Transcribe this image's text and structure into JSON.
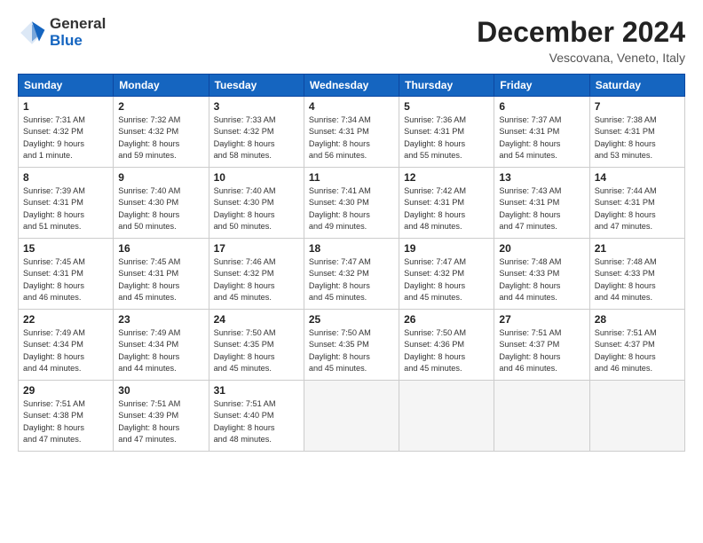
{
  "logo": {
    "general": "General",
    "blue": "Blue"
  },
  "title": {
    "month": "December 2024",
    "location": "Vescovana, Veneto, Italy"
  },
  "weekdays": [
    "Sunday",
    "Monday",
    "Tuesday",
    "Wednesday",
    "Thursday",
    "Friday",
    "Saturday"
  ],
  "weeks": [
    [
      {
        "day": "1",
        "lines": [
          "Sunrise: 7:31 AM",
          "Sunset: 4:32 PM",
          "Daylight: 9 hours",
          "and 1 minute."
        ]
      },
      {
        "day": "2",
        "lines": [
          "Sunrise: 7:32 AM",
          "Sunset: 4:32 PM",
          "Daylight: 8 hours",
          "and 59 minutes."
        ]
      },
      {
        "day": "3",
        "lines": [
          "Sunrise: 7:33 AM",
          "Sunset: 4:32 PM",
          "Daylight: 8 hours",
          "and 58 minutes."
        ]
      },
      {
        "day": "4",
        "lines": [
          "Sunrise: 7:34 AM",
          "Sunset: 4:31 PM",
          "Daylight: 8 hours",
          "and 56 minutes."
        ]
      },
      {
        "day": "5",
        "lines": [
          "Sunrise: 7:36 AM",
          "Sunset: 4:31 PM",
          "Daylight: 8 hours",
          "and 55 minutes."
        ]
      },
      {
        "day": "6",
        "lines": [
          "Sunrise: 7:37 AM",
          "Sunset: 4:31 PM",
          "Daylight: 8 hours",
          "and 54 minutes."
        ]
      },
      {
        "day": "7",
        "lines": [
          "Sunrise: 7:38 AM",
          "Sunset: 4:31 PM",
          "Daylight: 8 hours",
          "and 53 minutes."
        ]
      }
    ],
    [
      {
        "day": "8",
        "lines": [
          "Sunrise: 7:39 AM",
          "Sunset: 4:31 PM",
          "Daylight: 8 hours",
          "and 51 minutes."
        ]
      },
      {
        "day": "9",
        "lines": [
          "Sunrise: 7:40 AM",
          "Sunset: 4:30 PM",
          "Daylight: 8 hours",
          "and 50 minutes."
        ]
      },
      {
        "day": "10",
        "lines": [
          "Sunrise: 7:40 AM",
          "Sunset: 4:30 PM",
          "Daylight: 8 hours",
          "and 50 minutes."
        ]
      },
      {
        "day": "11",
        "lines": [
          "Sunrise: 7:41 AM",
          "Sunset: 4:30 PM",
          "Daylight: 8 hours",
          "and 49 minutes."
        ]
      },
      {
        "day": "12",
        "lines": [
          "Sunrise: 7:42 AM",
          "Sunset: 4:31 PM",
          "Daylight: 8 hours",
          "and 48 minutes."
        ]
      },
      {
        "day": "13",
        "lines": [
          "Sunrise: 7:43 AM",
          "Sunset: 4:31 PM",
          "Daylight: 8 hours",
          "and 47 minutes."
        ]
      },
      {
        "day": "14",
        "lines": [
          "Sunrise: 7:44 AM",
          "Sunset: 4:31 PM",
          "Daylight: 8 hours",
          "and 47 minutes."
        ]
      }
    ],
    [
      {
        "day": "15",
        "lines": [
          "Sunrise: 7:45 AM",
          "Sunset: 4:31 PM",
          "Daylight: 8 hours",
          "and 46 minutes."
        ]
      },
      {
        "day": "16",
        "lines": [
          "Sunrise: 7:45 AM",
          "Sunset: 4:31 PM",
          "Daylight: 8 hours",
          "and 45 minutes."
        ]
      },
      {
        "day": "17",
        "lines": [
          "Sunrise: 7:46 AM",
          "Sunset: 4:32 PM",
          "Daylight: 8 hours",
          "and 45 minutes."
        ]
      },
      {
        "day": "18",
        "lines": [
          "Sunrise: 7:47 AM",
          "Sunset: 4:32 PM",
          "Daylight: 8 hours",
          "and 45 minutes."
        ]
      },
      {
        "day": "19",
        "lines": [
          "Sunrise: 7:47 AM",
          "Sunset: 4:32 PM",
          "Daylight: 8 hours",
          "and 45 minutes."
        ]
      },
      {
        "day": "20",
        "lines": [
          "Sunrise: 7:48 AM",
          "Sunset: 4:33 PM",
          "Daylight: 8 hours",
          "and 44 minutes."
        ]
      },
      {
        "day": "21",
        "lines": [
          "Sunrise: 7:48 AM",
          "Sunset: 4:33 PM",
          "Daylight: 8 hours",
          "and 44 minutes."
        ]
      }
    ],
    [
      {
        "day": "22",
        "lines": [
          "Sunrise: 7:49 AM",
          "Sunset: 4:34 PM",
          "Daylight: 8 hours",
          "and 44 minutes."
        ]
      },
      {
        "day": "23",
        "lines": [
          "Sunrise: 7:49 AM",
          "Sunset: 4:34 PM",
          "Daylight: 8 hours",
          "and 44 minutes."
        ]
      },
      {
        "day": "24",
        "lines": [
          "Sunrise: 7:50 AM",
          "Sunset: 4:35 PM",
          "Daylight: 8 hours",
          "and 45 minutes."
        ]
      },
      {
        "day": "25",
        "lines": [
          "Sunrise: 7:50 AM",
          "Sunset: 4:35 PM",
          "Daylight: 8 hours",
          "and 45 minutes."
        ]
      },
      {
        "day": "26",
        "lines": [
          "Sunrise: 7:50 AM",
          "Sunset: 4:36 PM",
          "Daylight: 8 hours",
          "and 45 minutes."
        ]
      },
      {
        "day": "27",
        "lines": [
          "Sunrise: 7:51 AM",
          "Sunset: 4:37 PM",
          "Daylight: 8 hours",
          "and 46 minutes."
        ]
      },
      {
        "day": "28",
        "lines": [
          "Sunrise: 7:51 AM",
          "Sunset: 4:37 PM",
          "Daylight: 8 hours",
          "and 46 minutes."
        ]
      }
    ],
    [
      {
        "day": "29",
        "lines": [
          "Sunrise: 7:51 AM",
          "Sunset: 4:38 PM",
          "Daylight: 8 hours",
          "and 47 minutes."
        ]
      },
      {
        "day": "30",
        "lines": [
          "Sunrise: 7:51 AM",
          "Sunset: 4:39 PM",
          "Daylight: 8 hours",
          "and 47 minutes."
        ]
      },
      {
        "day": "31",
        "lines": [
          "Sunrise: 7:51 AM",
          "Sunset: 4:40 PM",
          "Daylight: 8 hours",
          "and 48 minutes."
        ]
      },
      null,
      null,
      null,
      null
    ]
  ]
}
